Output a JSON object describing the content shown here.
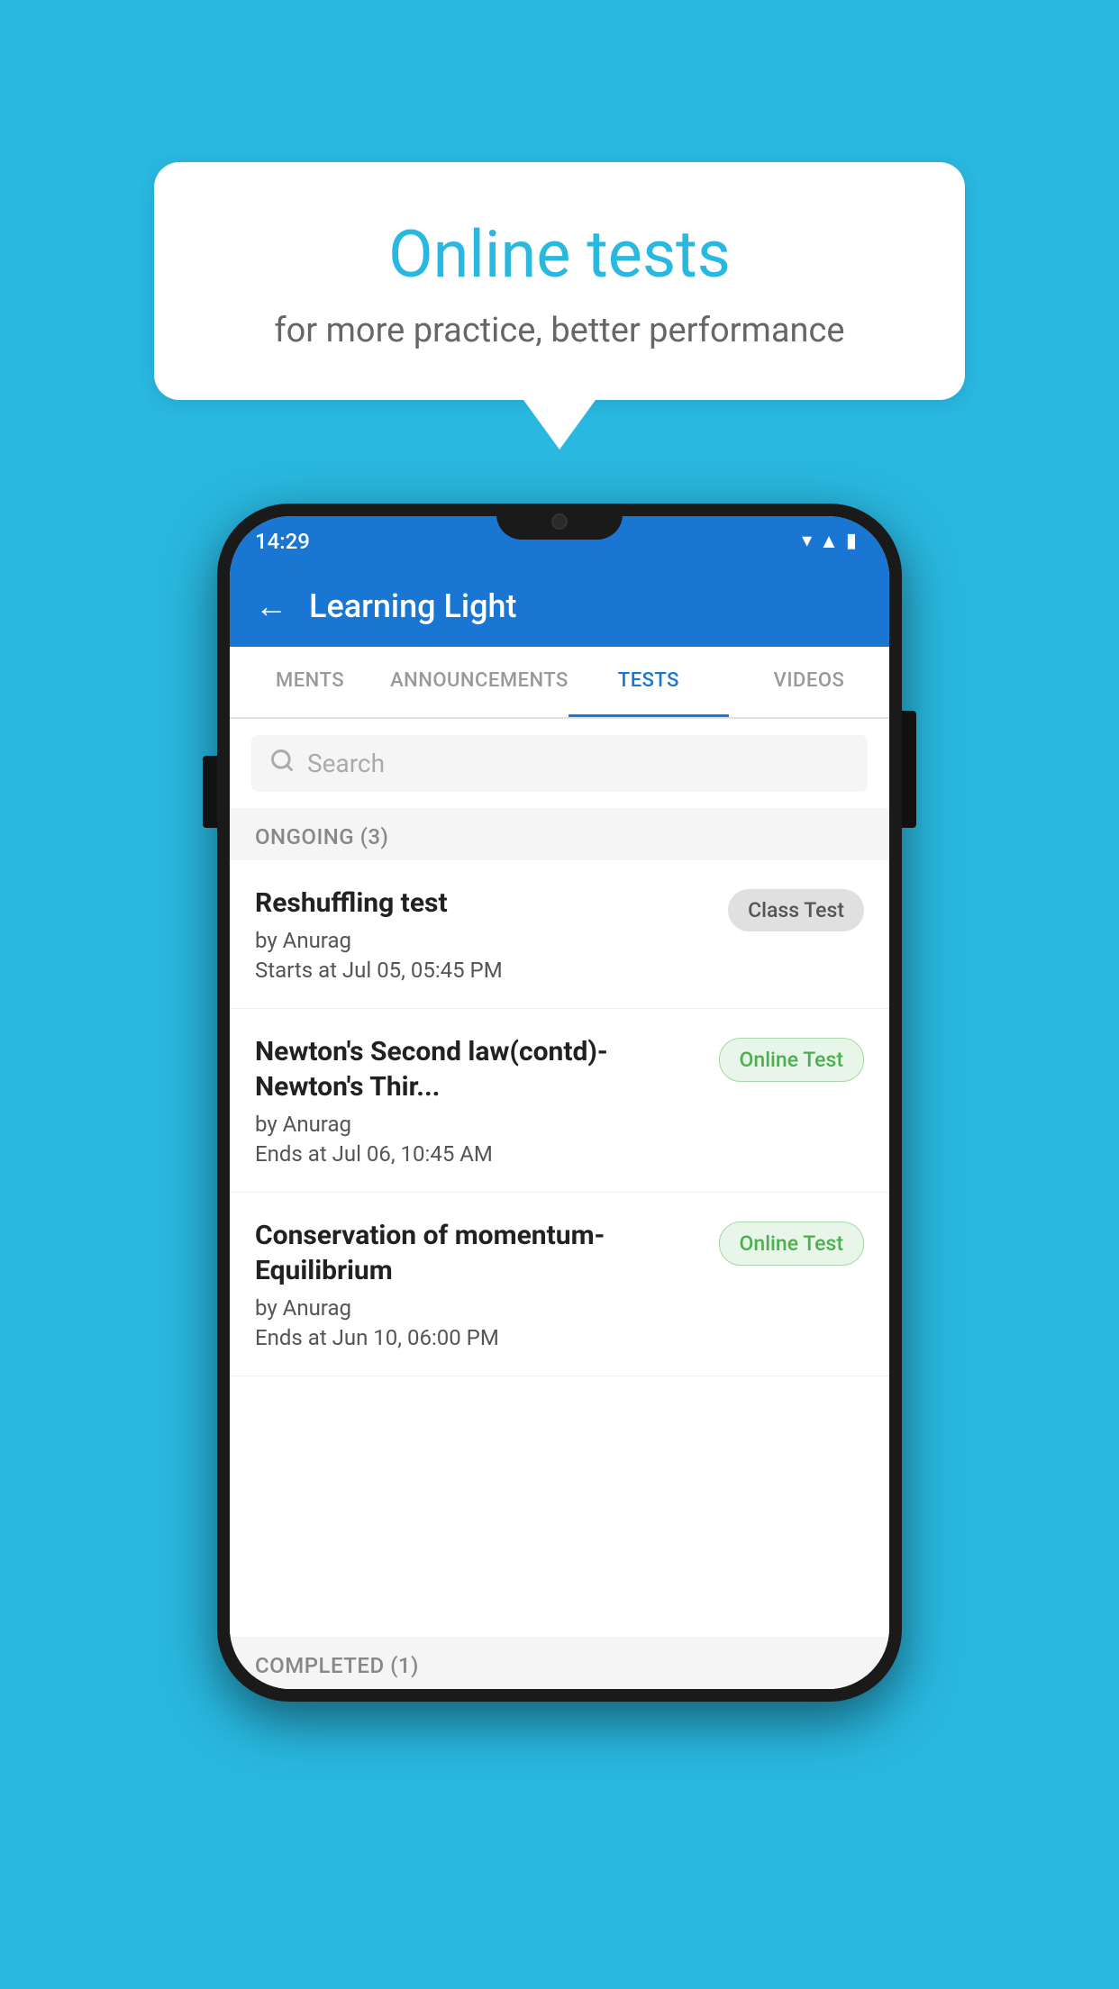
{
  "background_color": "#29b8e0",
  "speech_bubble": {
    "title": "Online tests",
    "subtitle": "for more practice, better performance"
  },
  "phone": {
    "status_bar": {
      "time": "14:29",
      "icons": [
        "wifi",
        "signal",
        "battery"
      ]
    },
    "app_bar": {
      "back_label": "←",
      "title": "Learning Light"
    },
    "tabs": [
      {
        "label": "MENTS",
        "active": false
      },
      {
        "label": "ANNOUNCEMENTS",
        "active": false
      },
      {
        "label": "TESTS",
        "active": true
      },
      {
        "label": "VIDEOS",
        "active": false
      }
    ],
    "search": {
      "placeholder": "Search"
    },
    "ongoing_section": {
      "header": "ONGOING (3)",
      "items": [
        {
          "title": "Reshuffling test",
          "author": "by Anurag",
          "date": "Starts at  Jul 05, 05:45 PM",
          "badge": "Class Test",
          "badge_type": "class"
        },
        {
          "title": "Newton's Second law(contd)-Newton's Thir...",
          "author": "by Anurag",
          "date": "Ends at  Jul 06, 10:45 AM",
          "badge": "Online Test",
          "badge_type": "online"
        },
        {
          "title": "Conservation of momentum-Equilibrium",
          "author": "by Anurag",
          "date": "Ends at  Jun 10, 06:00 PM",
          "badge": "Online Test",
          "badge_type": "online"
        }
      ]
    },
    "completed_section": {
      "header": "COMPLETED (1)"
    }
  }
}
